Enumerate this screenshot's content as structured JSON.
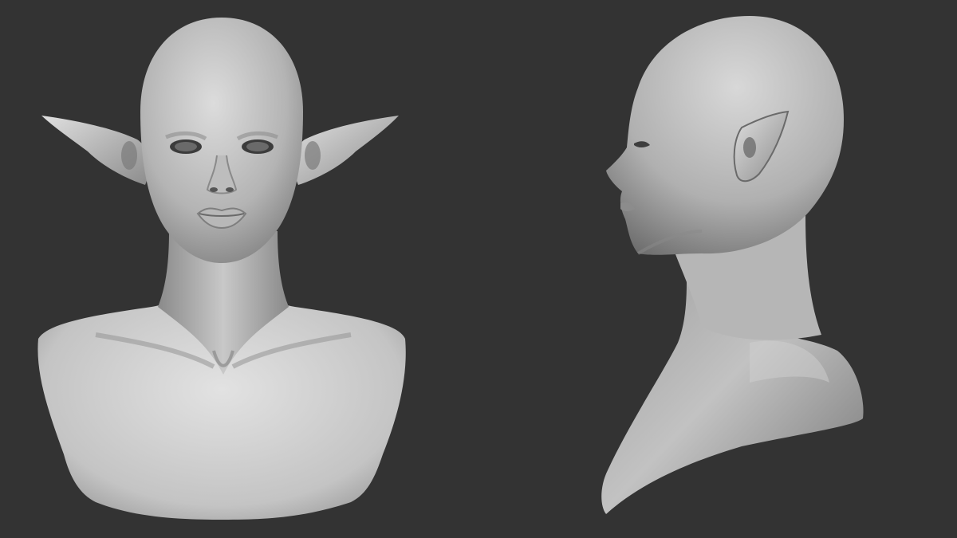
{
  "scene": {
    "background_color": "#333333",
    "clay_light": "#d6d6d6",
    "clay_mid": "#a9a9a9",
    "clay_dark": "#5e5e5e",
    "views": [
      {
        "id": "front",
        "subject": "elf-bust-front-view"
      },
      {
        "id": "side",
        "subject": "elf-bust-side-view"
      }
    ]
  }
}
